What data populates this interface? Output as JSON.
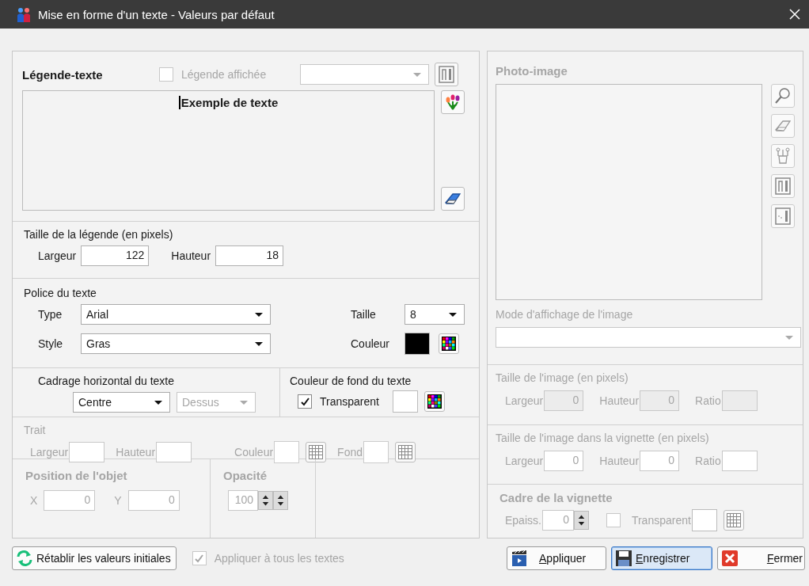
{
  "window": {
    "title": "Mise en forme d'un texte - Valeurs par défaut"
  },
  "legend": {
    "title": "Légende-texte",
    "show": {
      "label": "Légende affichée",
      "checked": false,
      "disabled": true
    },
    "sample_text": "Exemple de texte"
  },
  "legend_size": {
    "title": "Taille de la légende (en pixels)",
    "fields": [
      {
        "label": "Largeur",
        "value": "122"
      },
      {
        "label": "Hauteur",
        "value": "18"
      }
    ]
  },
  "font": {
    "title": "Police du texte",
    "type": {
      "label": "Type",
      "value": "Arial"
    },
    "style": {
      "label": "Style",
      "value": "Gras"
    },
    "size": {
      "label": "Taille",
      "value": "8"
    },
    "color": {
      "label": "Couleur",
      "color": "#000000"
    }
  },
  "alignment": {
    "title": "Cadrage horizontal du texte",
    "horizontal": {
      "value": "Centre",
      "disabled": false
    },
    "vertical": {
      "value": "Dessus",
      "disabled": true
    }
  },
  "background": {
    "title": "Couleur de fond du texte",
    "transparent": {
      "label": "Transparent",
      "checked": true
    }
  },
  "stroke": {
    "title": "Trait",
    "disabled": true,
    "fields": [
      {
        "label": "Largeur",
        "kind": "number"
      },
      {
        "label": "Hauteur",
        "kind": "number"
      },
      {
        "label": "Couleur",
        "kind": "color"
      },
      {
        "label": "Fond",
        "kind": "color"
      }
    ]
  },
  "position": {
    "title": "Position de l'objet",
    "disabled": true,
    "fields": [
      {
        "label": "X",
        "value": "0"
      },
      {
        "label": "Y",
        "value": "0"
      }
    ]
  },
  "opacity": {
    "title": "Opacité",
    "disabled": true,
    "value": "100"
  },
  "photo": {
    "title": "Photo-image",
    "disabled": true
  },
  "display_mode": {
    "label": "Mode d'affichage de l'image",
    "disabled": true
  },
  "image_size": {
    "title": "Taille de l'image (en pixels)",
    "disabled": true,
    "fields": [
      {
        "label": "Largeur",
        "value": "0",
        "readonly": true
      },
      {
        "label": "Hauteur",
        "value": "0",
        "readonly": true
      },
      {
        "label": "Ratio",
        "readonly": true
      }
    ]
  },
  "thumb_size": {
    "title": "Taille de l'image dans la vignette (en pixels)",
    "disabled": true,
    "fields": [
      {
        "label": "Largeur",
        "value": "0",
        "readonly": false
      },
      {
        "label": "Hauteur",
        "value": "0",
        "readonly": false
      },
      {
        "label": "Ratio",
        "readonly": false
      }
    ]
  },
  "frame": {
    "title": "Cadre de la vignette",
    "disabled": true,
    "thickness": {
      "label": "Epaiss.",
      "value": "0"
    },
    "transparent": {
      "label": "Transparent",
      "checked": false
    }
  },
  "footer": {
    "reset": "Rétablir les valeurs initiales",
    "apply_all": {
      "label": "Appliquer à tous les textes",
      "checked": true,
      "disabled": true
    },
    "buttons": [
      {
        "label": "Appliquer",
        "kind": "apply",
        "focused": false
      },
      {
        "label": "Enregistrer",
        "kind": "save",
        "focused": true
      },
      {
        "label": "Fermer",
        "kind": "close",
        "focused": false
      }
    ]
  }
}
